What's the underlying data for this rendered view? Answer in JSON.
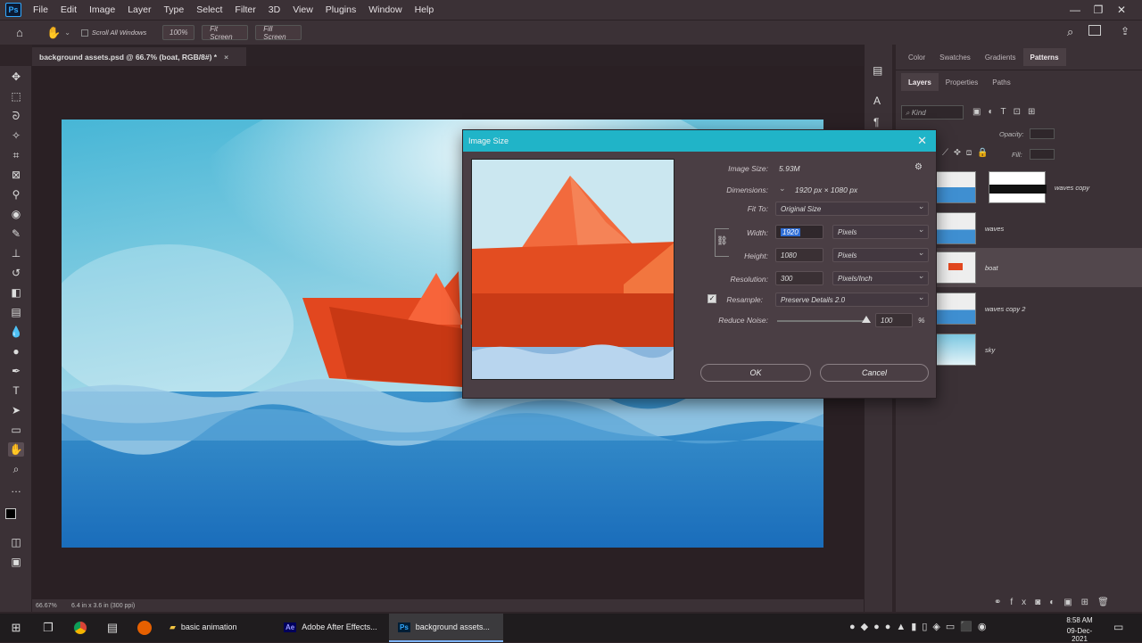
{
  "app": {
    "logo": "Ps"
  },
  "menu": [
    "File",
    "Edit",
    "Image",
    "Layer",
    "Type",
    "Select",
    "Filter",
    "3D",
    "View",
    "Plugins",
    "Window",
    "Help"
  ],
  "options_bar": {
    "scroll_all": "Scroll All Windows",
    "zoom": "100%",
    "fit1": "Fit Screen",
    "fit2": "Fill Screen"
  },
  "document": {
    "tab_title": "background assets.psd @ 66.7% (boat, RGB/8#) *",
    "zoom_status": "66.67%",
    "size_status": "6.4 in x 3.6 in (300 ppi)"
  },
  "panels": {
    "top_tabs": [
      "Color",
      "Swatches",
      "Gradients",
      "Patterns"
    ],
    "layer_tabs": [
      "Layers",
      "Properties",
      "Paths"
    ],
    "kind_placeholder": "Kind",
    "opacity_label": "Opacity:",
    "fill_label": "Fill:",
    "layers": [
      {
        "name": "waves copy"
      },
      {
        "name": "waves"
      },
      {
        "name": "boat"
      },
      {
        "name": "waves copy 2"
      },
      {
        "name": "sky"
      }
    ]
  },
  "dialog": {
    "title": "Image Size",
    "image_size_label": "Image Size:",
    "image_size_value": "5.93M",
    "dimensions_label": "Dimensions:",
    "dimensions_value": "1920 px  ×  1080 px",
    "fit_label": "Fit To:",
    "fit_value": "Original Size",
    "width_label": "Width:",
    "width_value": "1920",
    "width_unit": "Pixels",
    "height_label": "Height:",
    "height_value": "1080",
    "height_unit": "Pixels",
    "resolution_label": "Resolution:",
    "resolution_value": "300",
    "resolution_unit": "Pixels/Inch",
    "resample_label": "Resample:",
    "resample_value": "Preserve Details 2.0",
    "noise_label": "Reduce Noise:",
    "noise_value": "100",
    "noise_unit": "%",
    "ok": "OK",
    "cancel": "Cancel"
  },
  "taskbar": {
    "apps": [
      "basic animation",
      "Adobe After Effects...",
      "background assets..."
    ],
    "time": "8:58 AM",
    "date": "09-Dec-2021"
  }
}
